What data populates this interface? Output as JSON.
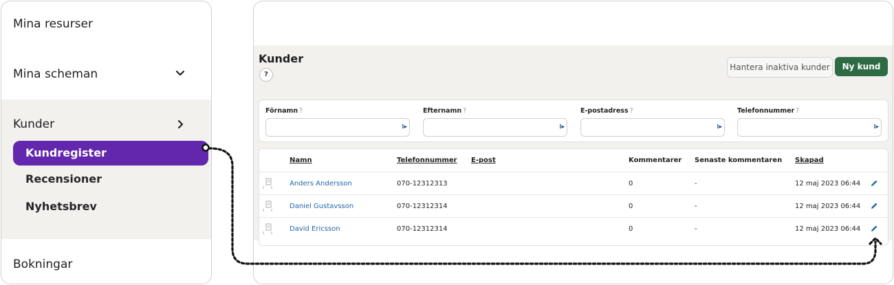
{
  "sidebar": {
    "items_top": [
      "Mina resurser",
      "Mina scheman"
    ],
    "group": {
      "label": "Kunder",
      "subitems": [
        "Kundregister",
        "Recensioner",
        "Nyhetsbrev"
      ],
      "active_index": 0
    },
    "items_bottom": [
      "Bokningar"
    ],
    "active_color": "#6227ad"
  },
  "main": {
    "title": "Kunder",
    "help": "?",
    "buttons": {
      "inactive": "Hantera inaktiva kunder",
      "new": "Ny kund"
    },
    "primary_color": "#2e6b45",
    "filters": {
      "fields": [
        {
          "label": "Förnamn",
          "help": "?",
          "value": ""
        },
        {
          "label": "Efternamn",
          "help": "?",
          "value": ""
        },
        {
          "label": "E-postadress",
          "help": "?",
          "value": ""
        },
        {
          "label": "Telefonnummer",
          "help": "?",
          "value": ""
        }
      ],
      "input_mark": "⁞▸"
    },
    "table": {
      "columns": [
        "Namn",
        "Telefonnummer",
        "E-post",
        "Kommentarer",
        "Senaste kommentaren",
        "Skapad"
      ],
      "rows": [
        {
          "name": "Anders Andersson",
          "phone": "070-12312313",
          "email": "",
          "comments": "0",
          "last_comment": "-",
          "created": "12 maj 2023 06:44"
        },
        {
          "name": "Daniel Gustavsson",
          "phone": "070-12312314",
          "email": "",
          "comments": "0",
          "last_comment": "-",
          "created": "12 maj 2023 06:44"
        },
        {
          "name": "David Ericsson",
          "phone": "070-12312314",
          "email": "",
          "comments": "0",
          "last_comment": "-",
          "created": "12 maj 2023 06:44"
        }
      ]
    }
  },
  "icons": [
    "chevron-down-icon",
    "chevron-right-icon",
    "document-icon",
    "pencil-icon"
  ]
}
